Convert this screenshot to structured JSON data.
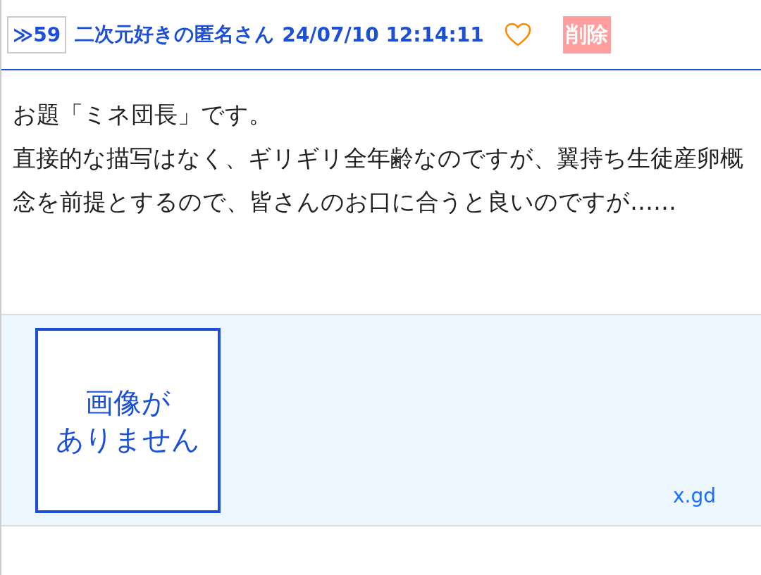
{
  "post": {
    "number": "≫59",
    "author": "二次元好きの匿名さん",
    "timestamp": "24/07/10 12:14:11",
    "liked": false,
    "delete_label": "削除",
    "body": [
      "お題「ミネ団長」です。",
      "直接的な描写はなく、ギリギリ全年齢なのですが、翼持ち生徒産卵概念を前提とするので、皆さんのお口に合うと良いのですが……"
    ]
  },
  "link_preview": {
    "image_placeholder": [
      "画像が",
      "ありません"
    ],
    "domain": "x.gd"
  }
}
